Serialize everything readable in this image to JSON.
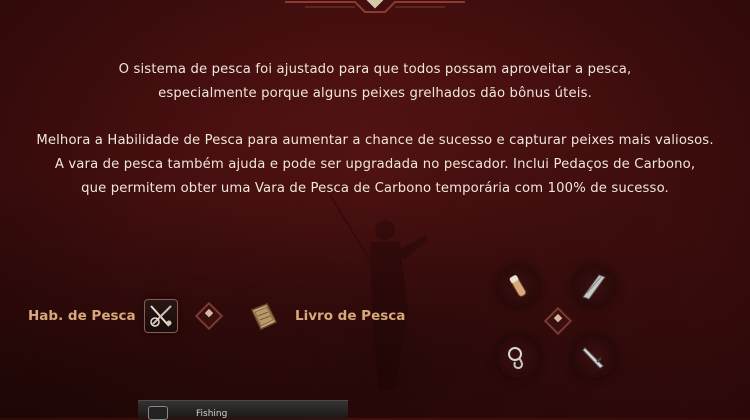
{
  "description": {
    "paragraph1_line1": "O sistema de pesca foi ajustado para que todos possam aproveitar a pesca,",
    "paragraph1_line2": "especialmente porque alguns peixes grelhados dão bônus úteis.",
    "paragraph2_line1": "Melhora a Habilidade de Pesca para aumentar a chance de sucesso e capturar peixes mais valiosos.",
    "paragraph2_line2": "A vara de pesca também ajuda e pode ser upgradada no pescador. Inclui Pedaços de Carbono,",
    "paragraph2_line3": "que permitem obter uma Vara de Pesca de Carbono temporária com 100% de sucesso."
  },
  "skills": {
    "skill_label": "Hab. de Pesca",
    "book_label": "Livro de Pesca"
  },
  "bottom_hud": {
    "label": "Fishing"
  },
  "icons": {
    "skill": "fishing-rod-icon",
    "book": "book-icon",
    "item1": "bait-icon",
    "item2": "fishing-float-icon",
    "item3": "hook-icon",
    "item4": "knife-icon"
  },
  "colors": {
    "accent": "#d9a87a",
    "background": "#4a1010"
  }
}
